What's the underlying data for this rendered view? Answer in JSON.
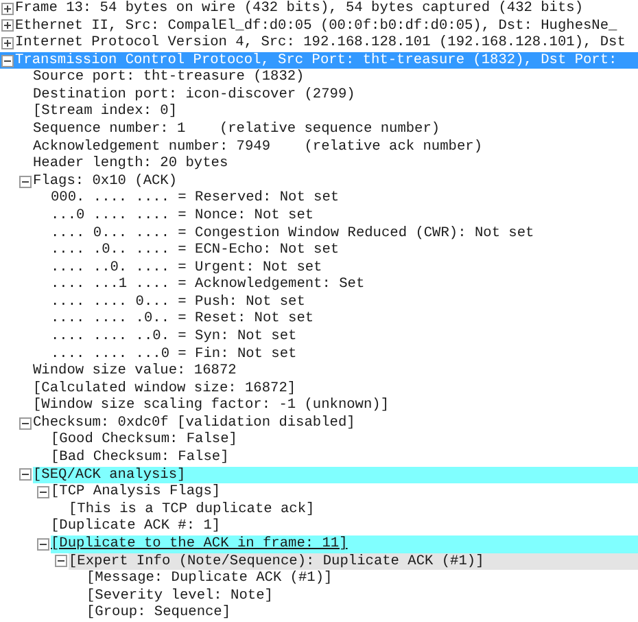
{
  "tree": [
    {
      "text": "Frame 13: 54 bytes on wire (432 bits), 54 bytes captured (432 bits)",
      "expanded": false,
      "selected": false
    },
    {
      "text": "Ethernet II, Src: CompalEl_df:d0:05 (00:0f:b0:df:d0:05), Dst: HughesNe_",
      "expanded": false,
      "selected": false
    },
    {
      "text": "Internet Protocol Version 4, Src: 192.168.128.101 (192.168.128.101), Dst",
      "expanded": false,
      "selected": false
    },
    {
      "text": "Transmission Control Protocol, Src Port: tht-treasure (1832), Dst Port:",
      "expanded": true,
      "selected": true,
      "children": [
        {
          "text": "Source port: tht-treasure (1832)",
          "selected": false
        },
        {
          "text": "Destination port: icon-discover (2799)",
          "selected": false
        },
        {
          "text": "[Stream index: 0]",
          "selected": false
        },
        {
          "text": "Sequence number: 1    (relative sequence number)",
          "selected": false
        },
        {
          "text": "Acknowledgement number: 7949    (relative ack number)",
          "selected": false
        },
        {
          "text": "Header length: 20 bytes",
          "selected": false
        },
        {
          "text": "Flags: 0x10 (ACK)",
          "expanded": true,
          "selected": false,
          "children": [
            {
              "text": "000. .... .... = Reserved: Not set",
              "selected": false
            },
            {
              "text": "...0 .... .... = Nonce: Not set",
              "selected": false
            },
            {
              "text": ".... 0... .... = Congestion Window Reduced (CWR): Not set",
              "selected": false
            },
            {
              "text": ".... .0.. .... = ECN-Echo: Not set",
              "selected": false
            },
            {
              "text": ".... ..0. .... = Urgent: Not set",
              "selected": false
            },
            {
              "text": ".... ...1 .... = Acknowledgement: Set",
              "selected": false
            },
            {
              "text": ".... .... 0... = Push: Not set",
              "selected": false
            },
            {
              "text": ".... .... .0.. = Reset: Not set",
              "selected": false
            },
            {
              "text": ".... .... ..0. = Syn: Not set",
              "selected": false
            },
            {
              "text": ".... .... ...0 = Fin: Not set",
              "selected": false
            }
          ]
        },
        {
          "text": "Window size value: 16872",
          "selected": false
        },
        {
          "text": "[Calculated window size: 16872]",
          "selected": false
        },
        {
          "text": "[Window size scaling factor: -1 (unknown)]",
          "selected": false
        },
        {
          "text": "Checksum: 0xdc0f [validation disabled]",
          "expanded": true,
          "selected": false,
          "children": [
            {
              "text": "[Good Checksum: False]",
              "selected": false
            },
            {
              "text": "[Bad Checksum: False]",
              "selected": false
            }
          ]
        },
        {
          "text": "[SEQ/ACK analysis]",
          "expanded": true,
          "selected": false,
          "color": "#80ffff",
          "children": [
            {
              "text": "[TCP Analysis Flags]",
              "expanded": true,
              "selected": false,
              "children": [
                {
                  "text": "[This is a TCP duplicate ack]",
                  "selected": false
                }
              ]
            },
            {
              "text": "[Duplicate ACK #: 1]",
              "selected": false
            },
            {
              "text": "[Duplicate to the ACK in frame: 11]",
              "expanded": true,
              "selected": false,
              "color": "#80ffff",
              "link": true,
              "children": [
                {
                  "text": "[Expert Info (Note/Sequence): Duplicate ACK (#1)]",
                  "expanded": true,
                  "selected": false,
                  "color": "#e4e4e4",
                  "children": [
                    {
                      "text": "[Message: Duplicate ACK (#1)]",
                      "selected": false
                    },
                    {
                      "text": "[Severity level: Note]",
                      "selected": false
                    },
                    {
                      "text": "[Group: Sequence]",
                      "selected": false
                    }
                  ]
                }
              ]
            }
          ]
        }
      ]
    }
  ]
}
